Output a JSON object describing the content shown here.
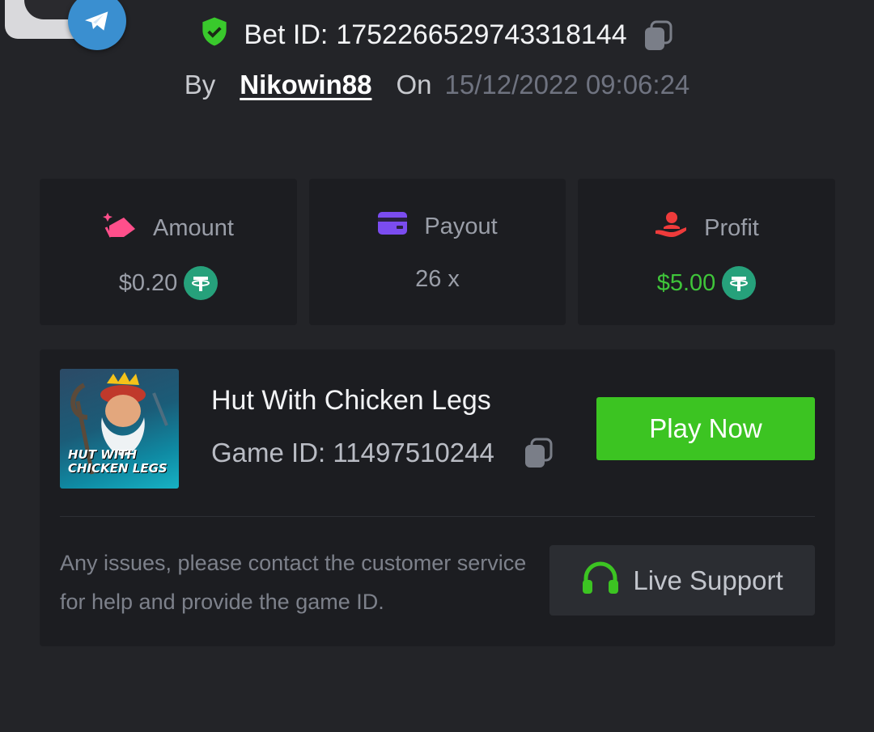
{
  "header": {
    "bet_id_label": "Bet ID:",
    "bet_id": "1752266529743318144",
    "by_label": "By",
    "username": "Nikowin88",
    "on_label": "On",
    "datetime": "15/12/2022 09:06:24"
  },
  "stats": [
    {
      "label": "Amount",
      "value": "$0.20",
      "icon": "money-icon"
    },
    {
      "label": "Payout",
      "value": "26 x",
      "icon": "card-icon"
    },
    {
      "label": "Profit",
      "value": "$5.00",
      "icon": "hand-person-icon"
    }
  ],
  "game": {
    "thumbnail_text": "HUT WITH CHICKEN LEGS",
    "name": "Hut With Chicken Legs",
    "id_label": "Game ID:",
    "id": "11497510244",
    "play_label": "Play Now"
  },
  "support": {
    "help_text": "Any issues, please contact the customer service for help and provide the game ID.",
    "button_label": "Live Support"
  },
  "colors": {
    "background": "#232428",
    "card": "#1c1d21",
    "accent_green": "#3cc422",
    "profit_green": "#3fc53a",
    "usdt": "#26a17b"
  }
}
